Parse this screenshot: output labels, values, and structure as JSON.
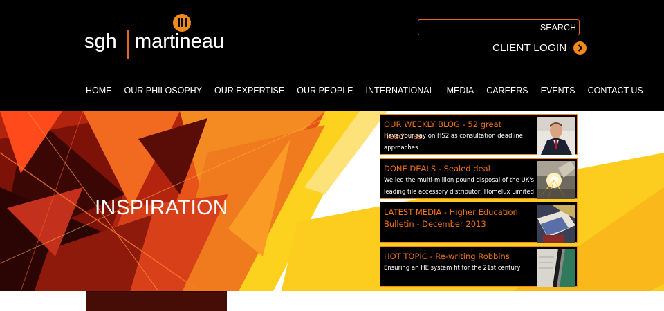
{
  "brand": {
    "left": "sgh",
    "right": "martineau"
  },
  "search": {
    "button_label": "SEARCH",
    "placeholder": ""
  },
  "client_login": {
    "label": "CLIENT LOGIN"
  },
  "nav": {
    "items": [
      "HOME",
      "OUR PHILOSOPHY",
      "OUR EXPERTISE",
      "OUR PEOPLE",
      "INTERNATIONAL",
      "MEDIA",
      "CAREERS",
      "EVENTS",
      "CONTACT US"
    ]
  },
  "hero": {
    "title": "INSPIRATION"
  },
  "news": [
    {
      "title": "OUR WEEKLY BLOG - 52 great headlines",
      "description": "Have your say on HS2 as consultation deadline approaches",
      "image": "man-in-suit-photo"
    },
    {
      "title": "DONE DEALS - Sealed deal",
      "description": "We led the multi-million pound disposal of the UK's leading tile accessory distributor, Homelux Limited",
      "image": "machinery-sparks-photo"
    },
    {
      "title": "LATEST MEDIA - Higher Education Bulletin - December 2013",
      "description": "",
      "image": "newsletter-pages-photo"
    },
    {
      "title": "HOT TOPIC - Re-writing Robbins",
      "description": "Ensuring an HE system fit for the 21st century",
      "image": "pen-on-paper-photo"
    }
  ],
  "colors": {
    "accent": "#f08a1c",
    "title_orange": "#f07218",
    "header_bg": "#000000",
    "hero_yellow": "#fccd1e"
  }
}
